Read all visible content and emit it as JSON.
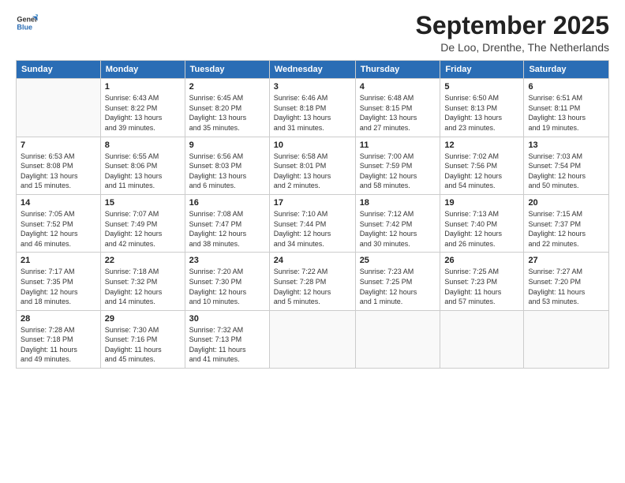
{
  "header": {
    "logo": {
      "general": "General",
      "blue": "Blue"
    },
    "title": "September 2025",
    "location": "De Loo, Drenthe, The Netherlands"
  },
  "calendar": {
    "days": [
      "Sunday",
      "Monday",
      "Tuesday",
      "Wednesday",
      "Thursday",
      "Friday",
      "Saturday"
    ],
    "weeks": [
      [
        {
          "day": "",
          "info": ""
        },
        {
          "day": "1",
          "info": "Sunrise: 6:43 AM\nSunset: 8:22 PM\nDaylight: 13 hours\nand 39 minutes."
        },
        {
          "day": "2",
          "info": "Sunrise: 6:45 AM\nSunset: 8:20 PM\nDaylight: 13 hours\nand 35 minutes."
        },
        {
          "day": "3",
          "info": "Sunrise: 6:46 AM\nSunset: 8:18 PM\nDaylight: 13 hours\nand 31 minutes."
        },
        {
          "day": "4",
          "info": "Sunrise: 6:48 AM\nSunset: 8:15 PM\nDaylight: 13 hours\nand 27 minutes."
        },
        {
          "day": "5",
          "info": "Sunrise: 6:50 AM\nSunset: 8:13 PM\nDaylight: 13 hours\nand 23 minutes."
        },
        {
          "day": "6",
          "info": "Sunrise: 6:51 AM\nSunset: 8:11 PM\nDaylight: 13 hours\nand 19 minutes."
        }
      ],
      [
        {
          "day": "7",
          "info": "Sunrise: 6:53 AM\nSunset: 8:08 PM\nDaylight: 13 hours\nand 15 minutes."
        },
        {
          "day": "8",
          "info": "Sunrise: 6:55 AM\nSunset: 8:06 PM\nDaylight: 13 hours\nand 11 minutes."
        },
        {
          "day": "9",
          "info": "Sunrise: 6:56 AM\nSunset: 8:03 PM\nDaylight: 13 hours\nand 6 minutes."
        },
        {
          "day": "10",
          "info": "Sunrise: 6:58 AM\nSunset: 8:01 PM\nDaylight: 13 hours\nand 2 minutes."
        },
        {
          "day": "11",
          "info": "Sunrise: 7:00 AM\nSunset: 7:59 PM\nDaylight: 12 hours\nand 58 minutes."
        },
        {
          "day": "12",
          "info": "Sunrise: 7:02 AM\nSunset: 7:56 PM\nDaylight: 12 hours\nand 54 minutes."
        },
        {
          "day": "13",
          "info": "Sunrise: 7:03 AM\nSunset: 7:54 PM\nDaylight: 12 hours\nand 50 minutes."
        }
      ],
      [
        {
          "day": "14",
          "info": "Sunrise: 7:05 AM\nSunset: 7:52 PM\nDaylight: 12 hours\nand 46 minutes."
        },
        {
          "day": "15",
          "info": "Sunrise: 7:07 AM\nSunset: 7:49 PM\nDaylight: 12 hours\nand 42 minutes."
        },
        {
          "day": "16",
          "info": "Sunrise: 7:08 AM\nSunset: 7:47 PM\nDaylight: 12 hours\nand 38 minutes."
        },
        {
          "day": "17",
          "info": "Sunrise: 7:10 AM\nSunset: 7:44 PM\nDaylight: 12 hours\nand 34 minutes."
        },
        {
          "day": "18",
          "info": "Sunrise: 7:12 AM\nSunset: 7:42 PM\nDaylight: 12 hours\nand 30 minutes."
        },
        {
          "day": "19",
          "info": "Sunrise: 7:13 AM\nSunset: 7:40 PM\nDaylight: 12 hours\nand 26 minutes."
        },
        {
          "day": "20",
          "info": "Sunrise: 7:15 AM\nSunset: 7:37 PM\nDaylight: 12 hours\nand 22 minutes."
        }
      ],
      [
        {
          "day": "21",
          "info": "Sunrise: 7:17 AM\nSunset: 7:35 PM\nDaylight: 12 hours\nand 18 minutes."
        },
        {
          "day": "22",
          "info": "Sunrise: 7:18 AM\nSunset: 7:32 PM\nDaylight: 12 hours\nand 14 minutes."
        },
        {
          "day": "23",
          "info": "Sunrise: 7:20 AM\nSunset: 7:30 PM\nDaylight: 12 hours\nand 10 minutes."
        },
        {
          "day": "24",
          "info": "Sunrise: 7:22 AM\nSunset: 7:28 PM\nDaylight: 12 hours\nand 5 minutes."
        },
        {
          "day": "25",
          "info": "Sunrise: 7:23 AM\nSunset: 7:25 PM\nDaylight: 12 hours\nand 1 minute."
        },
        {
          "day": "26",
          "info": "Sunrise: 7:25 AM\nSunset: 7:23 PM\nDaylight: 11 hours\nand 57 minutes."
        },
        {
          "day": "27",
          "info": "Sunrise: 7:27 AM\nSunset: 7:20 PM\nDaylight: 11 hours\nand 53 minutes."
        }
      ],
      [
        {
          "day": "28",
          "info": "Sunrise: 7:28 AM\nSunset: 7:18 PM\nDaylight: 11 hours\nand 49 minutes."
        },
        {
          "day": "29",
          "info": "Sunrise: 7:30 AM\nSunset: 7:16 PM\nDaylight: 11 hours\nand 45 minutes."
        },
        {
          "day": "30",
          "info": "Sunrise: 7:32 AM\nSunset: 7:13 PM\nDaylight: 11 hours\nand 41 minutes."
        },
        {
          "day": "",
          "info": ""
        },
        {
          "day": "",
          "info": ""
        },
        {
          "day": "",
          "info": ""
        },
        {
          "day": "",
          "info": ""
        }
      ]
    ]
  }
}
